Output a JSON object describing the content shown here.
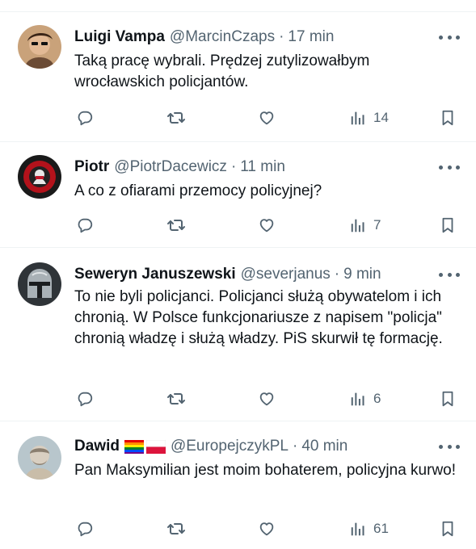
{
  "tweets": [
    {
      "name": "Luigi Vampa",
      "handle": "@MarcinCzaps",
      "separator": "·",
      "time": "17 min",
      "text": "Taką pracę wybrali. Prędzej zutylizowałbym wrocławskich policjantów.",
      "views": "14"
    },
    {
      "name": "Piotr",
      "handle": "@PiotrDacewicz",
      "separator": "·",
      "time": "11 min",
      "text": "A co z ofiarami przemocy policyjnej?",
      "views": "7"
    },
    {
      "name": "Seweryn Januszewski",
      "handle": "@severjanus",
      "separator": "·",
      "time": "9 min",
      "text": "To nie byli policjanci. Policjanci służą obywatelom i ich chronią. W Polsce funkcjonariusze z napisem \"policja\" chronią władzę i służą władzy. PiS skurwił tę formację.",
      "views": "6"
    },
    {
      "name": "Dawid",
      "handle": "@EuropejczykPL",
      "separator": "·",
      "time": "40 min",
      "text": "Pan Maksymilian jest moim bohaterem, policyjna kurwo!",
      "views": "61",
      "badges": [
        "rainbow-flag-icon",
        "poland-flag-icon"
      ]
    }
  ],
  "icons": [
    "reply-icon",
    "retweet-icon",
    "like-icon",
    "views-icon",
    "bookmark-icon",
    "more-icon"
  ],
  "colors": {
    "text": "#0f1419",
    "secondary": "#536471",
    "divider": "#eff3f4"
  }
}
